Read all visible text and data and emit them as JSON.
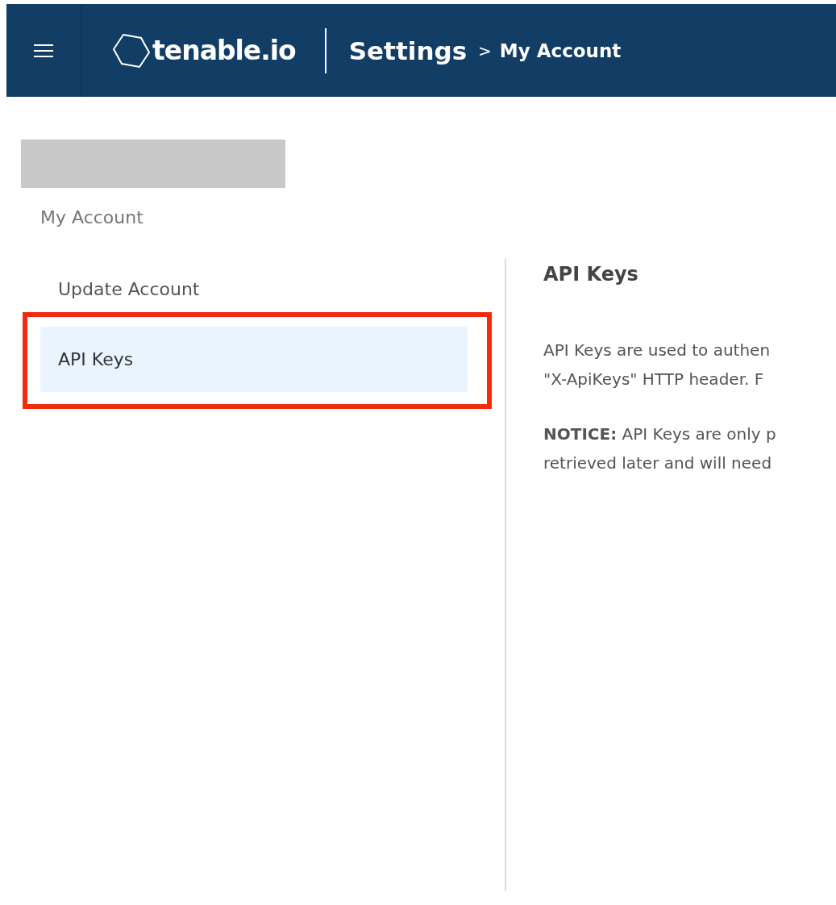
{
  "header": {
    "logo": "tenable.io",
    "title": "Settings",
    "separator": ">",
    "breadcrumb": "My Account"
  },
  "page": {
    "section_label": "My Account"
  },
  "sidebar": {
    "items": [
      {
        "label": "Update Account",
        "selected": false
      },
      {
        "label": "API Keys",
        "selected": true
      }
    ]
  },
  "content": {
    "title": "API Keys",
    "paragraphs": [
      [
        "API Keys are used to authen",
        "\"X-ApiKeys\" HTTP header. F"
      ],
      [
        "**NOTICE:** API Keys are only p",
        "retrieved later and will need"
      ]
    ]
  }
}
